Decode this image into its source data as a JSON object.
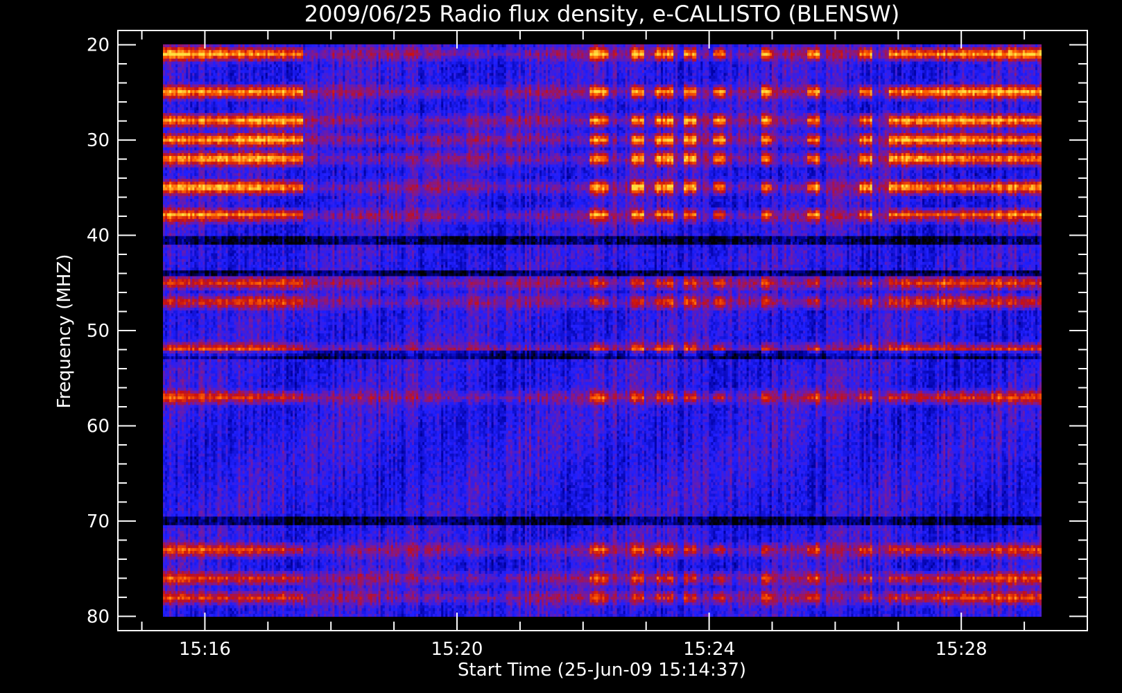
{
  "chart_data": {
    "type": "heatmap",
    "title": "2009/06/25  Radio flux density, e-CALLISTO (BLENSW)",
    "xlabel": "Start Time (25-Jun-09 15:14:37)",
    "ylabel": "Frequency (MHZ)",
    "x_tick_labels": [
      "15:16",
      "15:20",
      "15:24",
      "15:28"
    ],
    "x_tick_minutes": [
      16,
      20,
      24,
      28
    ],
    "xlim_minutes_after_15h": [
      14.62,
      30.0
    ],
    "y_tick_labels": [
      "20",
      "30",
      "40",
      "50",
      "60",
      "70",
      "80"
    ],
    "y_tick_values": [
      20,
      30,
      40,
      50,
      60,
      70,
      80
    ],
    "ylim": [
      18.5,
      81.5
    ],
    "y_inverted": true,
    "colormap": [
      "#000000",
      "#0000a0",
      "#2020ff",
      "#7a1a9a",
      "#c81010",
      "#ff6000",
      "#ffe040"
    ],
    "background": "#000000",
    "foreground": "#ffffff",
    "strong_emission_bands_mhz": [
      21,
      25,
      28,
      30,
      32,
      35,
      38,
      45,
      47,
      52,
      57,
      73,
      76,
      78
    ],
    "bright_time_segments_minutes": [
      [
        15.0,
        17.4
      ],
      [
        22.3,
        22.6
      ],
      [
        23.0,
        23.2
      ],
      [
        23.4,
        23.7
      ],
      [
        23.9,
        24.1
      ],
      [
        24.4,
        24.6
      ],
      [
        25.2,
        25.4
      ],
      [
        26.0,
        26.2
      ],
      [
        26.9,
        27.1
      ],
      [
        27.4,
        30.0
      ]
    ]
  }
}
